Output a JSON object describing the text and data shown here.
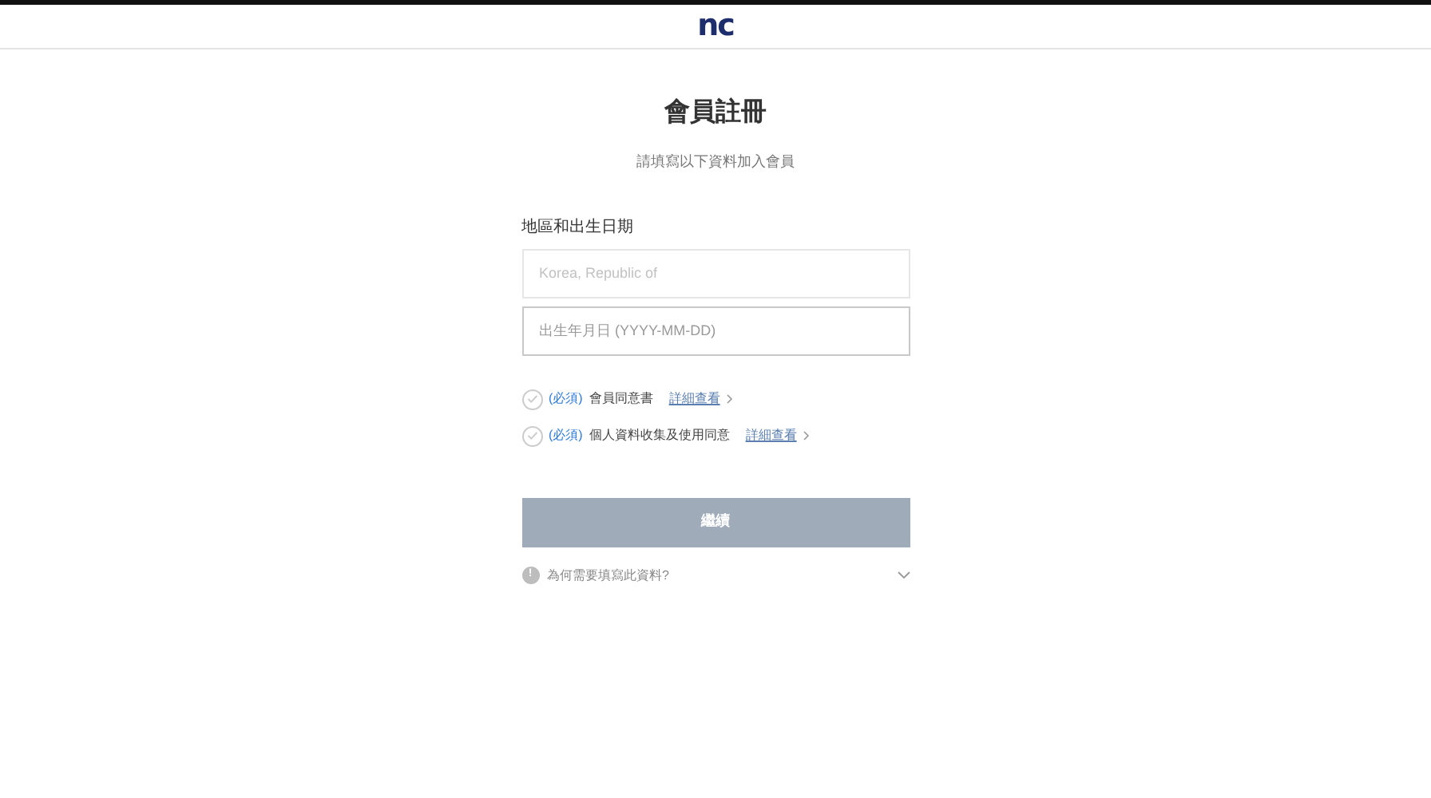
{
  "header": {
    "logo": "nc"
  },
  "title": "會員註冊",
  "subtitle": "請填寫以下資料加入會員",
  "section_label": "地區和出生日期",
  "fields": [
    {
      "placeholder": "Korea, Republic of",
      "disabled": true
    },
    {
      "placeholder": "出生年月日 (YYYY-MM-DD)",
      "disabled": false
    }
  ],
  "agreements": [
    {
      "required": "(必須)",
      "label": "會員同意書",
      "link": "詳細查看",
      "checked": false
    },
    {
      "required": "(必須)",
      "label": "個人資料收集及使用同意",
      "link": "詳細查看",
      "checked": false
    }
  ],
  "submit": {
    "label": "繼續",
    "disabled": true
  },
  "info": {
    "icon": "!",
    "label": "為何需要填寫此資料?",
    "expanded": false
  }
}
